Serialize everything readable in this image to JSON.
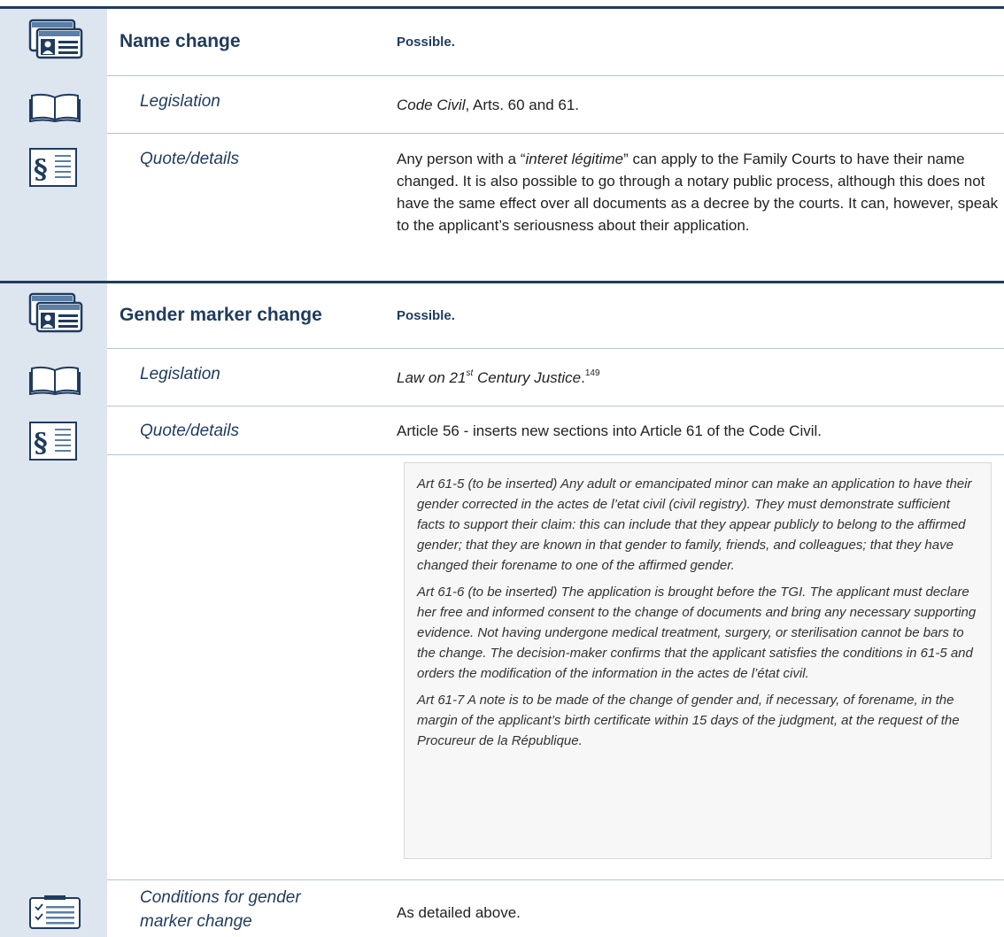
{
  "section1": {
    "title": "Name change",
    "status": "Possible.",
    "legislation_label": "Legislation",
    "legislation_title": "Code Civil",
    "legislation_rest": ", Arts. 60 and 61.",
    "details_label": "Quote/details",
    "details_pre": "Any person with a “",
    "details_term": "interet légitime",
    "details_post": "” can apply to the Family Courts to have their name changed. It is also possible to go through a notary public process, although this does not have the same effect over all documents as a decree by the courts. It can, however, speak to the applicant’s seriousness about their application."
  },
  "section2": {
    "title": "Gender marker change",
    "status": "Possible.",
    "legislation_label": "Legislation",
    "legislation_pre": "Law on 21",
    "legislation_sup": "st",
    "legislation_post": " Century Justice",
    "legislation_dot": ".",
    "footnote": "149",
    "details_label": "Quote/details",
    "details_text": "Article 56 - inserts new sections into Article 61 of the Code Civil.",
    "quotes": [
      "Art 61-5 (to be inserted) Any adult or emancipated minor can make an application to have their gender corrected in the actes de l’etat civil (civil registry). They must demonstrate sufficient facts to support their claim: this can include that they appear publicly to belong to the affirmed gender; that they are known in that gender to family, friends, and colleagues; that they have changed their forename to one of the affirmed gender.",
      "Art 61-6 (to be inserted) The application is brought before the TGI. The applicant must declare her free and informed consent to the change of documents and bring any necessary supporting evidence. Not having undergone medical treatment, surgery, or sterilisation cannot be bars to the change. The decision-maker confirms that the applicant satisfies the conditions in 61-5 and orders the modification of the information in the actes de l’état civil.",
      "Art 61-7 A note is to be made of the change of gender and, if necessary, of forename, in the margin of the applicant’s birth certificate within 15 days of the judgment, at the request of the Procureur de la République."
    ],
    "conditions_label_line1": "Conditions for gender",
    "conditions_label_line2": "marker change",
    "conditions_value": "As detailed above."
  },
  "icons": [
    "id-card-icon",
    "book-icon",
    "paragraph-document-icon",
    "checklist-icon"
  ],
  "colors": {
    "sidebar": "#dde5ef",
    "rule": "#1f3b5e",
    "heading": "#1f3b5e"
  }
}
